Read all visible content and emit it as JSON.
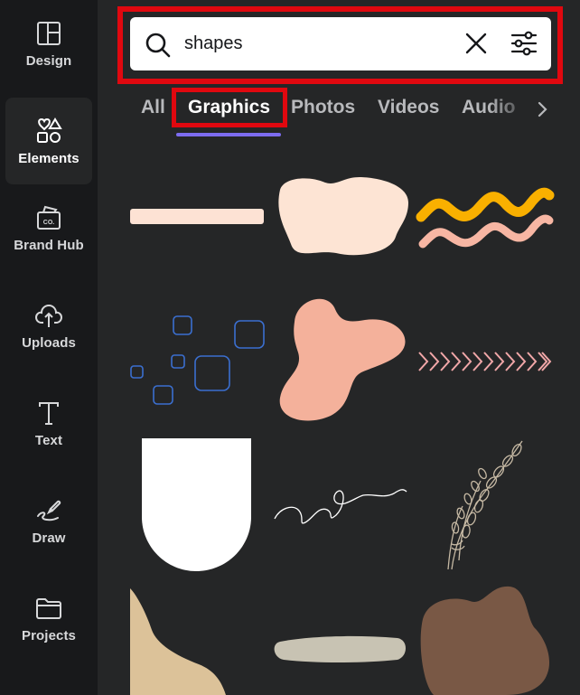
{
  "sidebar": {
    "items": [
      {
        "label": "Design",
        "icon": "layout-icon"
      },
      {
        "label": "Elements",
        "icon": "elements-icon",
        "active": true
      },
      {
        "label": "Brand Hub",
        "icon": "brand-hub-icon"
      },
      {
        "label": "Uploads",
        "icon": "cloud-upload-icon"
      },
      {
        "label": "Text",
        "icon": "text-icon"
      },
      {
        "label": "Draw",
        "icon": "draw-icon"
      },
      {
        "label": "Projects",
        "icon": "folder-icon"
      }
    ]
  },
  "search": {
    "value": "shapes",
    "clear_icon": "close-icon",
    "filter_icon": "filter-sliders-icon"
  },
  "tabs": [
    {
      "label": "All"
    },
    {
      "label": "Graphics",
      "active": true
    },
    {
      "label": "Photos"
    },
    {
      "label": "Videos"
    },
    {
      "label": "Audio"
    }
  ],
  "colors": {
    "panel_bg": "#252627",
    "rail_bg": "#18191b",
    "highlight_red": "#e0080f",
    "tab_underline": "#7d6cf0"
  },
  "results": [
    {
      "name": "peach-rounded-bar"
    },
    {
      "name": "cream-blob"
    },
    {
      "name": "orange-pink-squiggles"
    },
    {
      "name": "blue-outline-squares"
    },
    {
      "name": "salmon-organic-blob"
    },
    {
      "name": "pink-chevron-arrows"
    },
    {
      "name": "white-arch-shape"
    },
    {
      "name": "white-line-scribble"
    },
    {
      "name": "lavender-sprig-illustration"
    },
    {
      "name": "beige-corner-shape"
    },
    {
      "name": "gray-brush-stroke"
    },
    {
      "name": "brown-organic-blob"
    }
  ]
}
